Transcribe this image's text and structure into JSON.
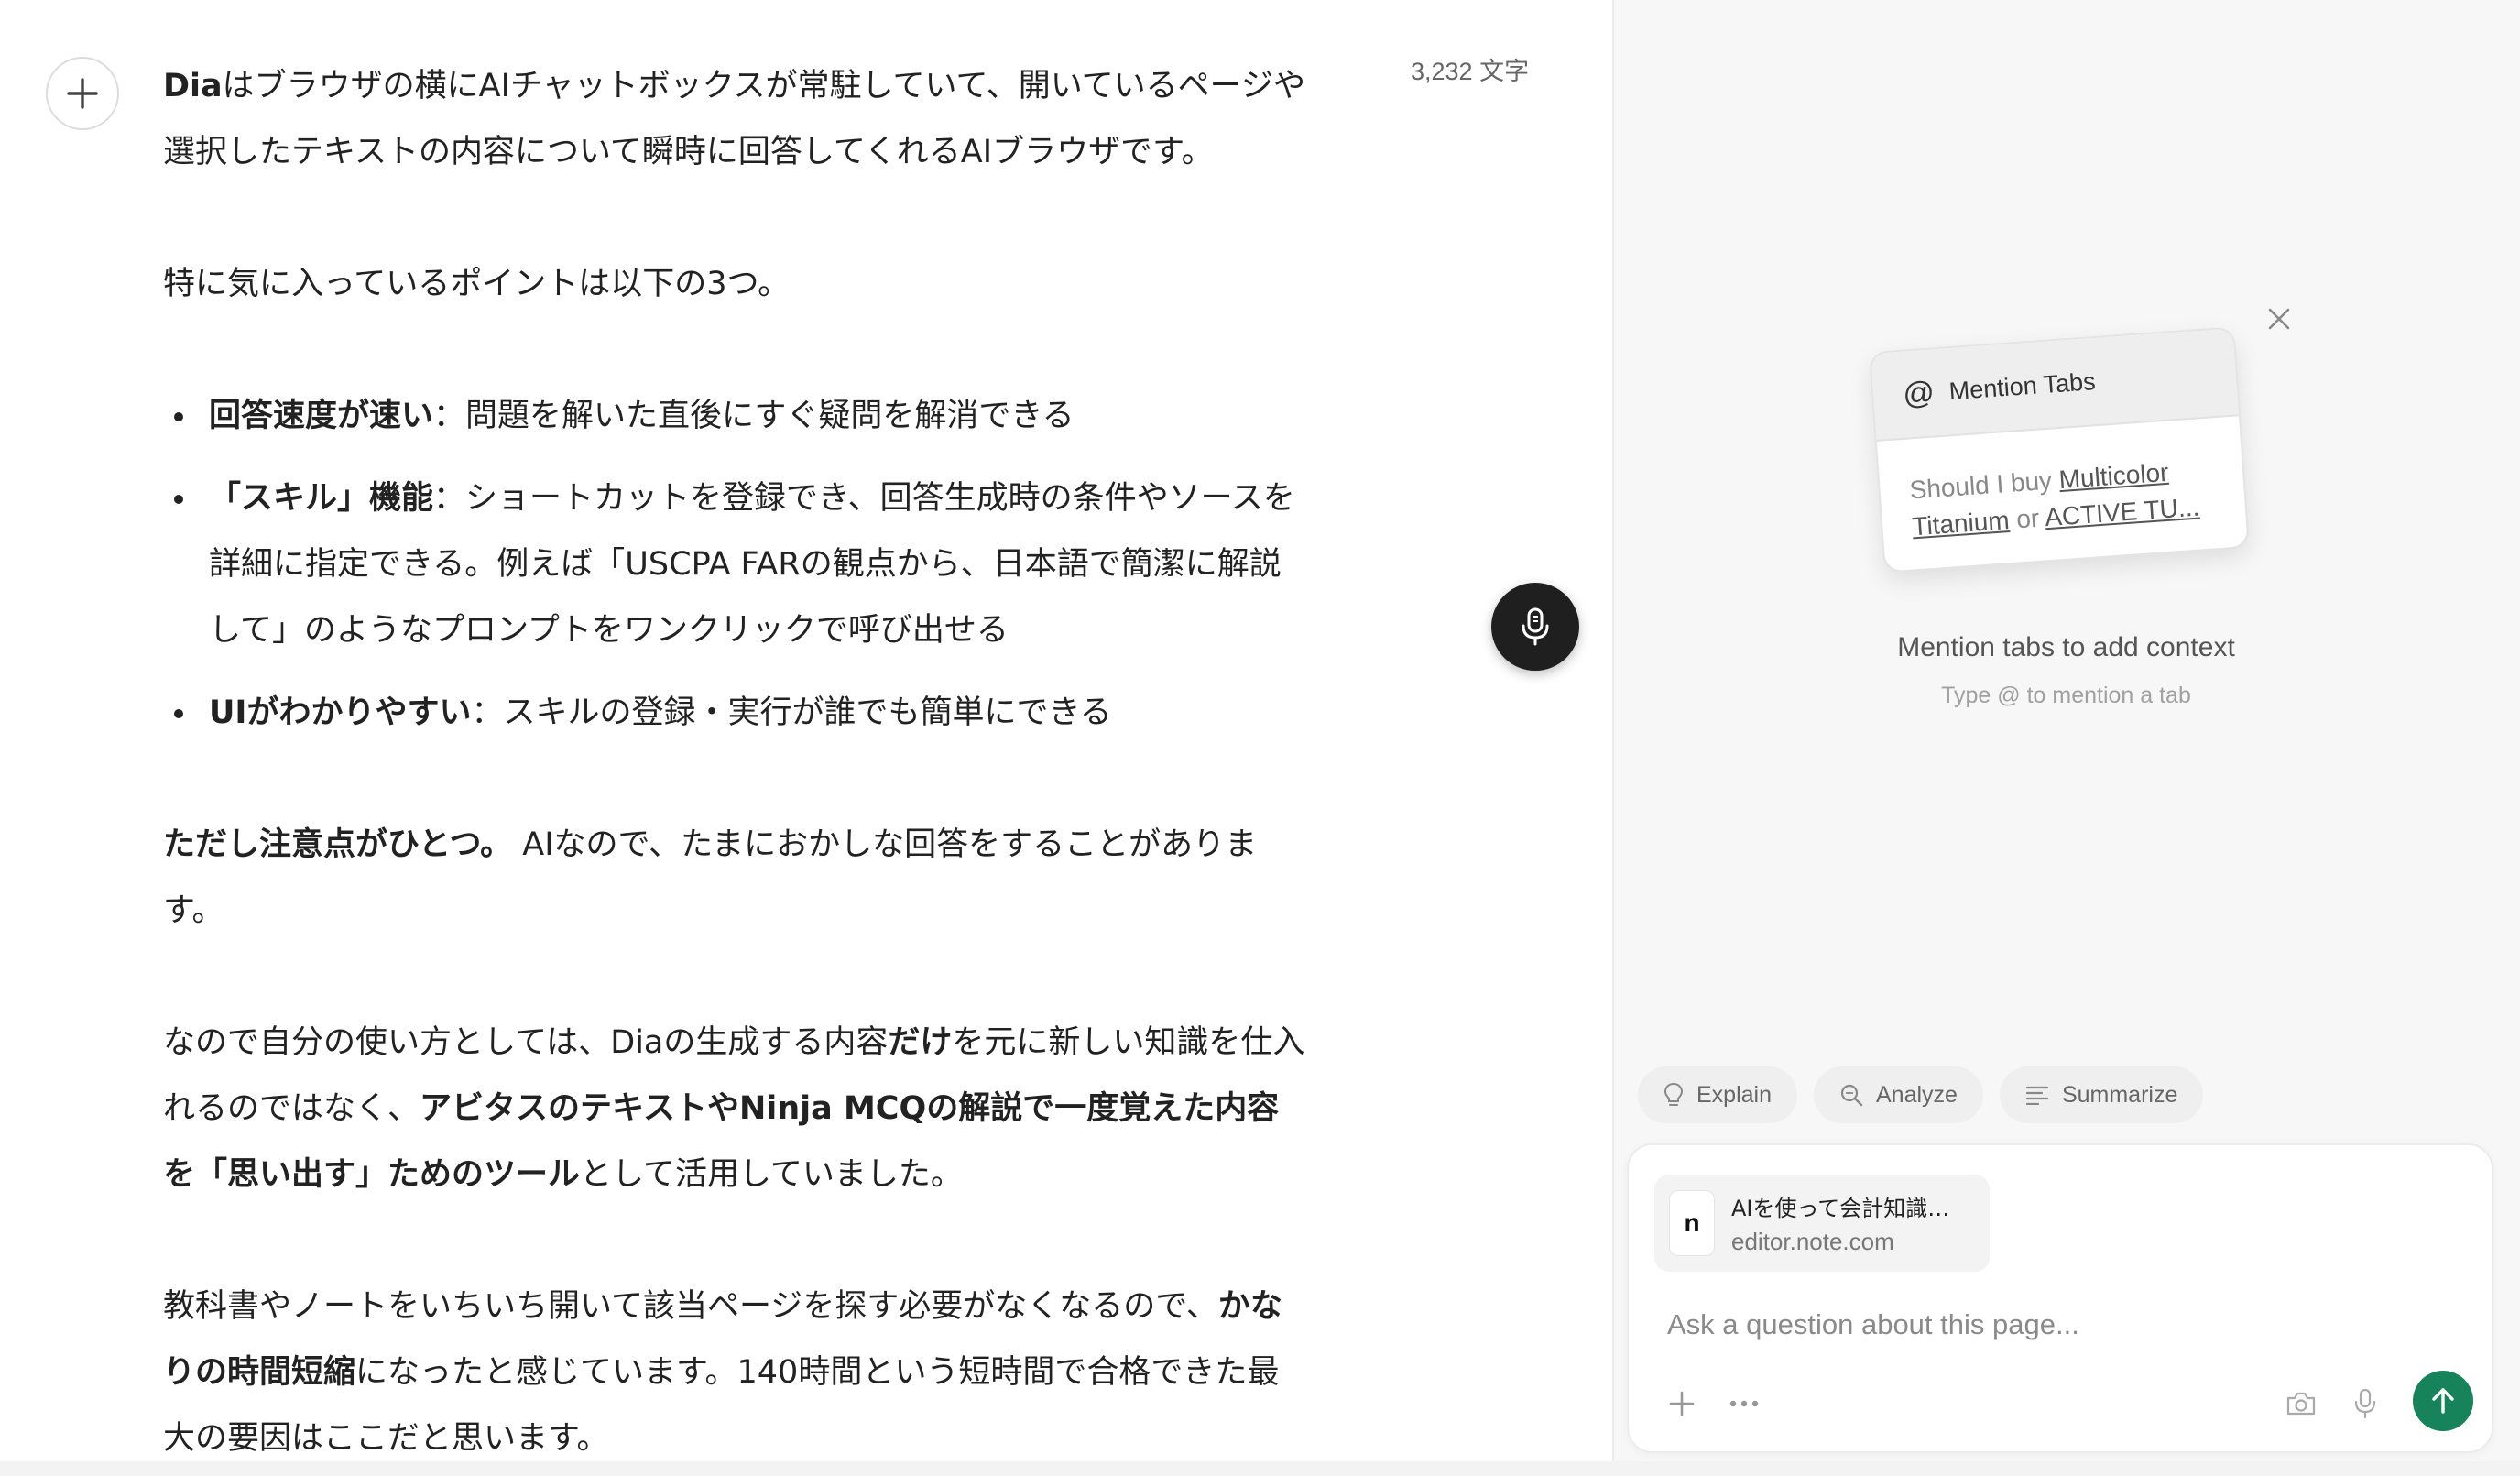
{
  "editor": {
    "word_count": "3,232 文字",
    "paragraphs": {
      "p1": {
        "b1": "Dia",
        "t1": "はブラウザの横にAIチャットボックスが常駐していて、開いているページや選択したテキストの内容について瞬時に回答してくれるAIブラウザです。"
      },
      "p2": "特に気に入っているポイントは以下の3つ。",
      "list": [
        {
          "bold": "回答速度が速い",
          "text": "：問題を解いた直後にすぐ疑問を解消できる"
        },
        {
          "bold": "「スキル」機能",
          "text": "：ショートカットを登録でき、回答生成時の条件やソースを詳細に指定できる。例えば「USCPA FARの観点から、日本語で簡潔に解説して」のようなプロンプトをワンクリックで呼び出せる"
        },
        {
          "bold": "UIがわかりやすい",
          "text": "：スキルの登録・実行が誰でも簡単にできる"
        }
      ],
      "p3": {
        "b1": "ただし注意点がひとつ。",
        "t1": " AIなので、たまにおかしな回答をすることがあります。"
      },
      "p4": {
        "t1": "なので自分の使い方としては、Diaの生成する内容",
        "b1": "だけ",
        "t2": "を元に新しい知識を仕入れるのではなく、",
        "b2": "アビタスのテキストやNinja MCQの解説で一度覚えた内容を「思い出す」ためのツール",
        "t3": "として活用していました。"
      },
      "p5": {
        "t1": "教科書やノートをいちいち開いて該当ページを探す必要がなくなるので、",
        "b1": "かなりの時間短縮",
        "t2": "になったと感じています。140時間という短時間で合格できた最大の要因はここだと思います。"
      }
    }
  },
  "assistant": {
    "mention_card": {
      "header": "Mention Tabs",
      "at_symbol": "@",
      "body_prefix": "Should I buy ",
      "link1": "Multicolor Titanium",
      "body_mid": " or ",
      "link2": "ACTIVE TU..."
    },
    "mention_title": "Mention tabs to add context",
    "mention_sub": "Type @ to mention a tab",
    "chips": [
      "Explain",
      "Analyze",
      "Summarize"
    ],
    "context_tab": {
      "logo": "n",
      "title": "AIを使って会計知識…",
      "url": "editor.note.com"
    },
    "input_placeholder": "Ask a question about this page..."
  },
  "colors": {
    "send_button": "#16835a",
    "mic_fab": "#1f1f1f"
  }
}
